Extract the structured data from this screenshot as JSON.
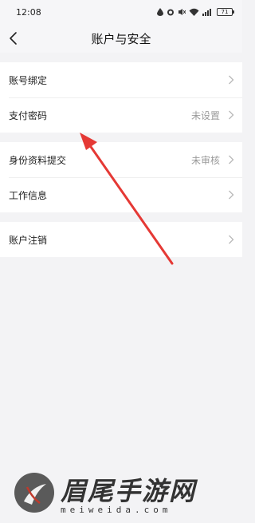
{
  "status_bar": {
    "time": "12:08",
    "battery": "71"
  },
  "nav": {
    "title": "账户与安全"
  },
  "groups": [
    [
      {
        "label": "账号绑定",
        "value": ""
      },
      {
        "label": "支付密码",
        "value": "未设置"
      }
    ],
    [
      {
        "label": "身份资料提交",
        "value": "未审核"
      },
      {
        "label": "工作信息",
        "value": ""
      }
    ],
    [
      {
        "label": "账户注销",
        "value": ""
      }
    ]
  ],
  "annotation": {
    "color": "#e53935"
  },
  "watermark": {
    "brand": "眉尾手游网",
    "url": "meiweida.com"
  }
}
